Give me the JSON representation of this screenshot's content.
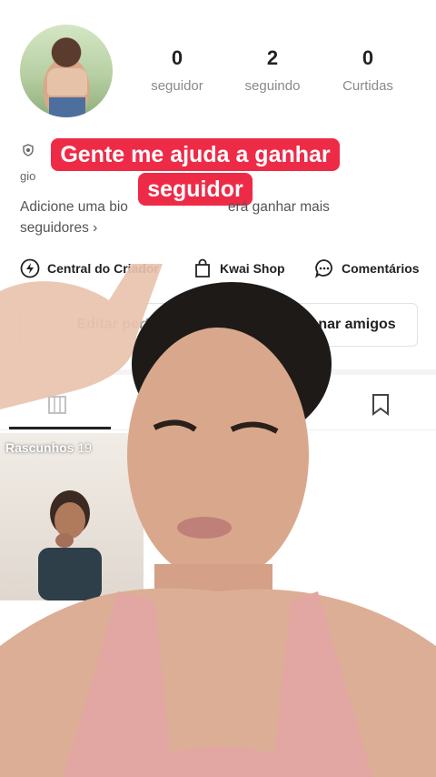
{
  "profile": {
    "stats": [
      {
        "value": "0",
        "label": "seguidor"
      },
      {
        "value": "2",
        "label": "seguindo"
      },
      {
        "value": "0",
        "label": "Curtidas"
      }
    ],
    "id_prefix": "gio",
    "bio_text": "Adicione uma bio",
    "bio_text_tail": "erá ganhar mais",
    "bio_line2": "seguidores",
    "bio_chevron": "›"
  },
  "caption": {
    "line1": "Gente me ajuda a ganhar",
    "line2": "seguidor"
  },
  "actions": [
    {
      "label": "Central do Criador",
      "icon": "lightning-icon"
    },
    {
      "label": "Kwai Shop",
      "icon": "shopping-bag-icon"
    },
    {
      "label": "Comentários",
      "icon": "comment-icon"
    }
  ],
  "buttons": {
    "edit_profile": "Editar perfil",
    "find_friends": "nar amigos"
  },
  "tabs": {
    "bookmark_icon": "bookmark-icon",
    "grid_icon": "grid-icon"
  },
  "drafts": {
    "label": "Rascunhos",
    "count": "19"
  },
  "colors": {
    "caption_bg": "#ee2b47",
    "caption_text": "#ffffff",
    "muted_text": "#8a8a8a"
  }
}
